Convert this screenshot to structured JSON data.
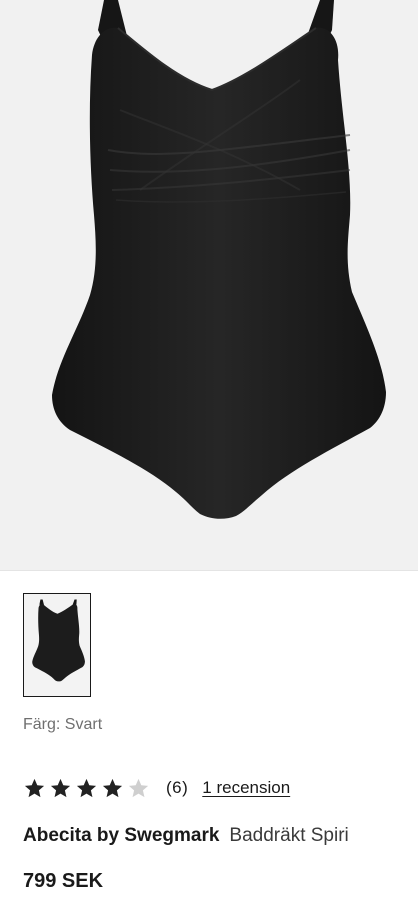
{
  "product": {
    "color_line": "Färg: Svart",
    "rating": {
      "stars_filled": 4,
      "stars_total": 5,
      "count_text": "(6)",
      "review_link": "1 recension"
    },
    "brand": "Abecita by Swegmark",
    "name": "Baddräkt Spiri",
    "price": "799 SEK"
  },
  "colors": {
    "swimsuit": "#1c1c1c",
    "hero_background": "#f1f1f1"
  }
}
